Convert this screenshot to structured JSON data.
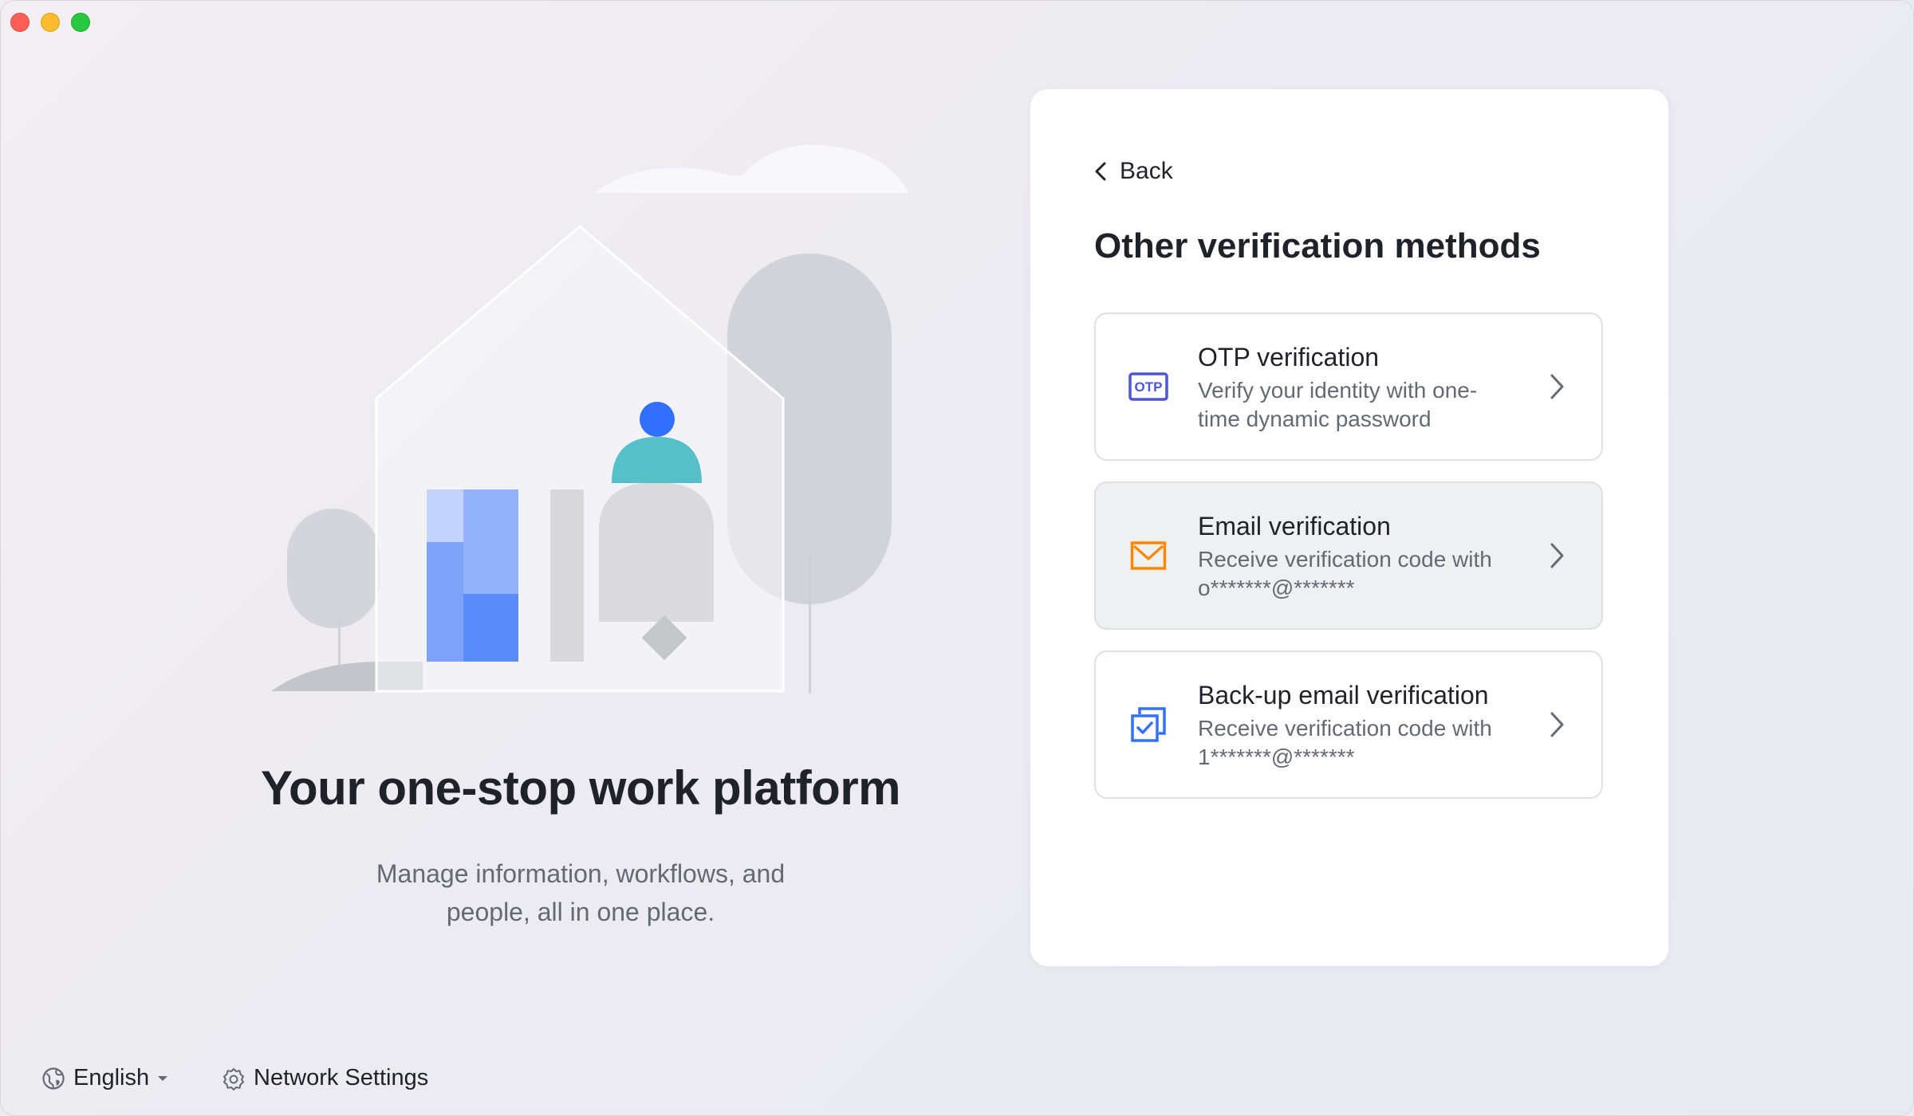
{
  "window": {
    "controls": [
      "close",
      "minimize",
      "maximize"
    ]
  },
  "hero": {
    "headline": "Your one-stop work platform",
    "subtext_line1": "Manage information, workflows, and",
    "subtext_line2": "people, all in one place."
  },
  "footer": {
    "language": "English",
    "network_settings": "Network Settings"
  },
  "panel": {
    "back_label": "Back",
    "title": "Other verification methods",
    "methods": [
      {
        "icon": "otp-icon",
        "icon_text": "OTP",
        "title": "OTP verification",
        "desc_line1": "Verify your identity with one-",
        "desc_line2": "time dynamic password"
      },
      {
        "icon": "envelope-icon",
        "title": "Email verification",
        "desc_line1": "Receive verification code with",
        "desc_line2": "o*******@*******",
        "state": "hover"
      },
      {
        "icon": "backup-email-icon",
        "title": "Back-up email verification",
        "desc_line1": "Receive verification code with",
        "desc_line2": "1*******@*******"
      }
    ]
  },
  "colors": {
    "accent_blue": "#3370ff",
    "otp_icon": "#4e55d9",
    "email_icon": "#ff8800",
    "teal": "#55c0c8",
    "text_primary": "#1f2329",
    "text_secondary": "#646a73",
    "card_border": "#dee0e3",
    "hover_bg": "#eff0f1"
  }
}
